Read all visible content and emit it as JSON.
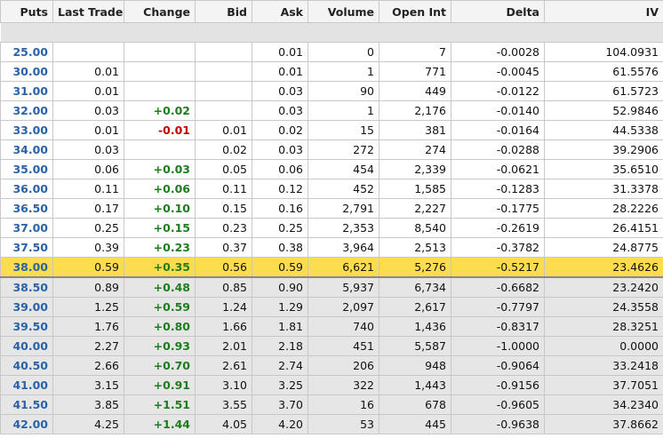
{
  "columns": [
    "Puts",
    "Last Trade",
    "Change",
    "Bid",
    "Ask",
    "Volume",
    "Open Int",
    "Delta",
    "IV"
  ],
  "rows": [
    {
      "strike": "25.00",
      "last": "",
      "change": "",
      "dir": "",
      "bid": "",
      "ask": "0.01",
      "volume": "0",
      "oi": "7",
      "delta": "-0.0028",
      "iv": "104.0931",
      "zone": "itm"
    },
    {
      "strike": "30.00",
      "last": "0.01",
      "change": "",
      "dir": "",
      "bid": "",
      "ask": "0.01",
      "volume": "1",
      "oi": "771",
      "delta": "-0.0045",
      "iv": "61.5576",
      "zone": "itm"
    },
    {
      "strike": "31.00",
      "last": "0.01",
      "change": "",
      "dir": "",
      "bid": "",
      "ask": "0.03",
      "volume": "90",
      "oi": "449",
      "delta": "-0.0122",
      "iv": "61.5723",
      "zone": "itm"
    },
    {
      "strike": "32.00",
      "last": "0.03",
      "change": "+0.02",
      "dir": "pos",
      "bid": "",
      "ask": "0.03",
      "volume": "1",
      "oi": "2,176",
      "delta": "-0.0140",
      "iv": "52.9846",
      "zone": "itm"
    },
    {
      "strike": "33.00",
      "last": "0.01",
      "change": "-0.01",
      "dir": "neg",
      "bid": "0.01",
      "ask": "0.02",
      "volume": "15",
      "oi": "381",
      "delta": "-0.0164",
      "iv": "44.5338",
      "zone": "itm"
    },
    {
      "strike": "34.00",
      "last": "0.03",
      "change": "",
      "dir": "",
      "bid": "0.02",
      "ask": "0.03",
      "volume": "272",
      "oi": "274",
      "delta": "-0.0288",
      "iv": "39.2906",
      "zone": "itm"
    },
    {
      "strike": "35.00",
      "last": "0.06",
      "change": "+0.03",
      "dir": "pos",
      "bid": "0.05",
      "ask": "0.06",
      "volume": "454",
      "oi": "2,339",
      "delta": "-0.0621",
      "iv": "35.6510",
      "zone": "itm"
    },
    {
      "strike": "36.00",
      "last": "0.11",
      "change": "+0.06",
      "dir": "pos",
      "bid": "0.11",
      "ask": "0.12",
      "volume": "452",
      "oi": "1,585",
      "delta": "-0.1283",
      "iv": "31.3378",
      "zone": "itm"
    },
    {
      "strike": "36.50",
      "last": "0.17",
      "change": "+0.10",
      "dir": "pos",
      "bid": "0.15",
      "ask": "0.16",
      "volume": "2,791",
      "oi": "2,227",
      "delta": "-0.1775",
      "iv": "28.2226",
      "zone": "itm"
    },
    {
      "strike": "37.00",
      "last": "0.25",
      "change": "+0.15",
      "dir": "pos",
      "bid": "0.23",
      "ask": "0.25",
      "volume": "2,353",
      "oi": "8,540",
      "delta": "-0.2619",
      "iv": "26.4151",
      "zone": "itm"
    },
    {
      "strike": "37.50",
      "last": "0.39",
      "change": "+0.23",
      "dir": "pos",
      "bid": "0.37",
      "ask": "0.38",
      "volume": "3,964",
      "oi": "2,513",
      "delta": "-0.3782",
      "iv": "24.8775",
      "zone": "itm"
    },
    {
      "strike": "38.00",
      "last": "0.59",
      "change": "+0.35",
      "dir": "pos",
      "bid": "0.56",
      "ask": "0.59",
      "volume": "6,621",
      "oi": "5,276",
      "delta": "-0.5217",
      "iv": "23.4626",
      "zone": "atm"
    },
    {
      "strike": "38.50",
      "last": "0.89",
      "change": "+0.48",
      "dir": "pos",
      "bid": "0.85",
      "ask": "0.90",
      "volume": "5,937",
      "oi": "6,734",
      "delta": "-0.6682",
      "iv": "23.2420",
      "zone": "otm"
    },
    {
      "strike": "39.00",
      "last": "1.25",
      "change": "+0.59",
      "dir": "pos",
      "bid": "1.24",
      "ask": "1.29",
      "volume": "2,097",
      "oi": "2,617",
      "delta": "-0.7797",
      "iv": "24.3558",
      "zone": "otm"
    },
    {
      "strike": "39.50",
      "last": "1.76",
      "change": "+0.80",
      "dir": "pos",
      "bid": "1.66",
      "ask": "1.81",
      "volume": "740",
      "oi": "1,436",
      "delta": "-0.8317",
      "iv": "28.3251",
      "zone": "otm"
    },
    {
      "strike": "40.00",
      "last": "2.27",
      "change": "+0.93",
      "dir": "pos",
      "bid": "2.01",
      "ask": "2.18",
      "volume": "451",
      "oi": "5,587",
      "delta": "-1.0000",
      "iv": "0.0000",
      "zone": "otm"
    },
    {
      "strike": "40.50",
      "last": "2.66",
      "change": "+0.70",
      "dir": "pos",
      "bid": "2.61",
      "ask": "2.74",
      "volume": "206",
      "oi": "948",
      "delta": "-0.9064",
      "iv": "33.2418",
      "zone": "otm"
    },
    {
      "strike": "41.00",
      "last": "3.15",
      "change": "+0.91",
      "dir": "pos",
      "bid": "3.10",
      "ask": "3.25",
      "volume": "322",
      "oi": "1,443",
      "delta": "-0.9156",
      "iv": "37.7051",
      "zone": "otm"
    },
    {
      "strike": "41.50",
      "last": "3.85",
      "change": "+1.51",
      "dir": "pos",
      "bid": "3.55",
      "ask": "3.70",
      "volume": "16",
      "oi": "678",
      "delta": "-0.9605",
      "iv": "34.2340",
      "zone": "otm"
    },
    {
      "strike": "42.00",
      "last": "4.25",
      "change": "+1.44",
      "dir": "pos",
      "bid": "4.05",
      "ask": "4.20",
      "volume": "53",
      "oi": "445",
      "delta": "-0.9638",
      "iv": "37.8662",
      "zone": "otm"
    }
  ],
  "colors": {
    "strike": "#2a62a8",
    "positive": "#1d7d1d",
    "negative": "#c00000",
    "atm_highlight": "#fddc4e",
    "otm_shade": "#e6e6e6"
  }
}
